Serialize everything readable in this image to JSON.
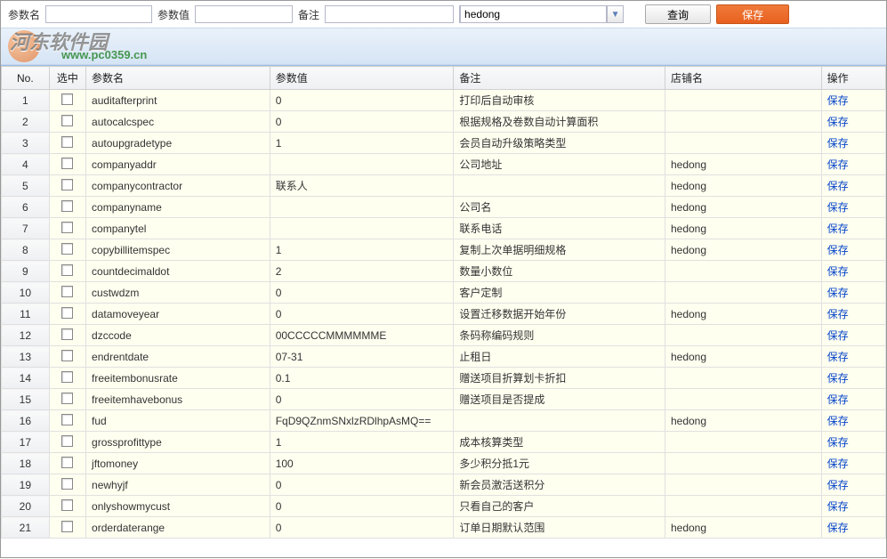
{
  "filter": {
    "param_name_label": "参数名",
    "param_name_value": "",
    "param_value_label": "参数值",
    "param_value_value": "",
    "remark_label": "备注",
    "remark_value": "",
    "store_value": "hedong",
    "query_btn": "查询",
    "save_btn": "保存"
  },
  "watermark": {
    "logo_text": "河东软件园",
    "url_text": "www.pc0359.cn"
  },
  "columns": {
    "no": "No.",
    "sel": "选中",
    "name": "参数名",
    "value": "参数值",
    "remark": "备注",
    "store": "店铺名",
    "op": "操作"
  },
  "op_label": "保存",
  "rows": [
    {
      "no": "1",
      "name": "auditafterprint",
      "value": "0",
      "remark": "打印后自动审核",
      "store": ""
    },
    {
      "no": "2",
      "name": "autocalcspec",
      "value": "0",
      "remark": "根据规格及卷数自动计算面积",
      "store": ""
    },
    {
      "no": "3",
      "name": "autoupgradetype",
      "value": "1",
      "remark": "会员自动升级策略类型",
      "store": ""
    },
    {
      "no": "4",
      "name": "companyaddr",
      "value": "",
      "remark": "公司地址",
      "store": "hedong"
    },
    {
      "no": "5",
      "name": "companycontractor",
      "value": "联系人",
      "remark": "",
      "store": "hedong"
    },
    {
      "no": "6",
      "name": "companyname",
      "value": "",
      "remark": "公司名",
      "store": "hedong"
    },
    {
      "no": "7",
      "name": "companytel",
      "value": "",
      "remark": "联系电话",
      "store": "hedong"
    },
    {
      "no": "8",
      "name": "copybillitemspec",
      "value": "1",
      "remark": "复制上次单据明细规格",
      "store": "hedong"
    },
    {
      "no": "9",
      "name": "countdecimaldot",
      "value": "2",
      "remark": "数量小数位",
      "store": ""
    },
    {
      "no": "10",
      "name": "custwdzm",
      "value": "0",
      "remark": "客户定制",
      "store": ""
    },
    {
      "no": "11",
      "name": "datamoveyear",
      "value": "0",
      "remark": "设置迁移数据开始年份",
      "store": "hedong"
    },
    {
      "no": "12",
      "name": "dzccode",
      "value": "00CCCCCMMMMMME",
      "remark": "条码称编码规则",
      "store": ""
    },
    {
      "no": "13",
      "name": "endrentdate",
      "value": "07-31",
      "remark": "止租日",
      "store": "hedong"
    },
    {
      "no": "14",
      "name": "freeitembonusrate",
      "value": "0.1",
      "remark": "赠送项目折算划卡折扣",
      "store": ""
    },
    {
      "no": "15",
      "name": "freeitemhavebonus",
      "value": "0",
      "remark": "赠送项目是否提成",
      "store": ""
    },
    {
      "no": "16",
      "name": "fud",
      "value": "FqD9QZnmSNxlzRDlhpAsMQ==",
      "remark": "",
      "store": "hedong"
    },
    {
      "no": "17",
      "name": "grossprofittype",
      "value": "1",
      "remark": "成本核算类型",
      "store": ""
    },
    {
      "no": "18",
      "name": "jftomoney",
      "value": "100",
      "remark": "多少积分抵1元",
      "store": ""
    },
    {
      "no": "19",
      "name": "newhyjf",
      "value": "0",
      "remark": "新会员激活送积分",
      "store": ""
    },
    {
      "no": "20",
      "name": "onlyshowmycust",
      "value": "0",
      "remark": "只看自己的客户",
      "store": ""
    },
    {
      "no": "21",
      "name": "orderdaterange",
      "value": "0",
      "remark": "订单日期默认范围",
      "store": "hedong"
    }
  ]
}
